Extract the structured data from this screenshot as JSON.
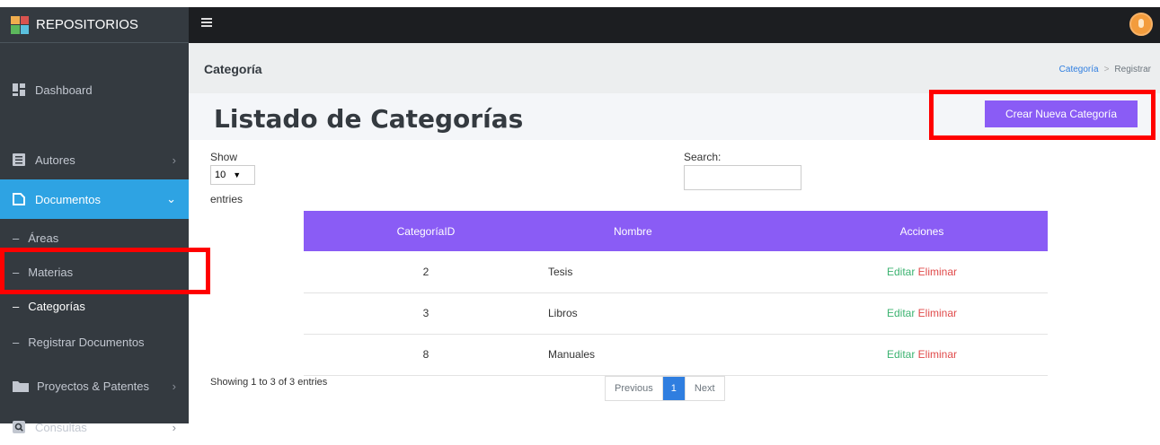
{
  "brand": {
    "name": "REPOSITORIOS"
  },
  "sidebar": {
    "items": [
      {
        "label": "Dashboard",
        "icon": "dashboard-icon"
      },
      {
        "label": "Autores",
        "icon": "list-icon"
      },
      {
        "label": "Documentos",
        "icon": "document-icon",
        "active": true
      },
      {
        "label": "Áreas"
      },
      {
        "label": "Materias"
      },
      {
        "label": "Categorías",
        "current": true
      },
      {
        "label": "Registrar Documentos"
      },
      {
        "label": "Proyectos & Patentes",
        "icon": "folder-icon"
      },
      {
        "label": "Consultas",
        "icon": "search-icon"
      }
    ]
  },
  "header": {
    "page_title": "Categoría",
    "breadcrumb": [
      "Categoría",
      "Registrar"
    ]
  },
  "main": {
    "title": "Listado de Categorías",
    "new_button": "Crear Nueva Categoría",
    "show_label": "Show",
    "page_size": "10",
    "entries_label": "entries",
    "search_label": "Search:",
    "columns": [
      "CategoríaID",
      "Nombre",
      "Acciones"
    ],
    "rows": [
      {
        "id": "2",
        "name": "Tesis",
        "edit": "Editar",
        "delete": "Eliminar"
      },
      {
        "id": "3",
        "name": "Libros",
        "edit": "Editar",
        "delete": "Eliminar"
      },
      {
        "id": "8",
        "name": "Manuales",
        "edit": "Editar",
        "delete": "Eliminar"
      }
    ],
    "info": "Showing 1 to 3 of 3 entries",
    "pager": {
      "prev": "Previous",
      "current": "1",
      "next": "Next"
    }
  },
  "colors": {
    "sidebar_bg": "#343a40",
    "active_blue": "#2ea3e3",
    "accent_purple": "#8a5cf5",
    "highlight_red": "#ff0000"
  }
}
